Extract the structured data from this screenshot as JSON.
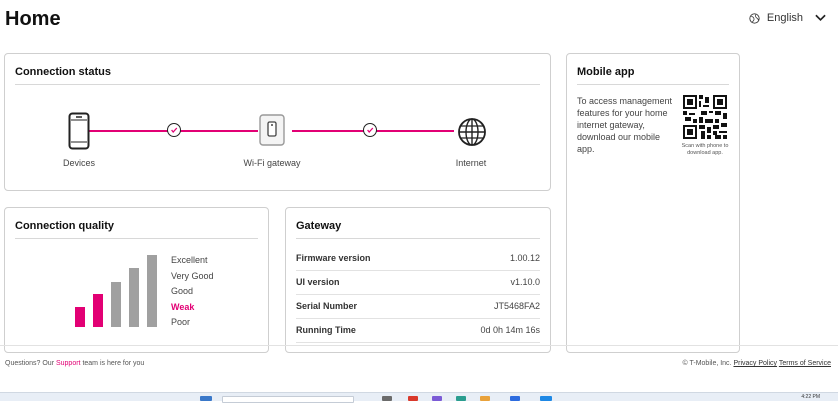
{
  "header": {
    "title": "Home",
    "language": "English",
    "globe_icon": "globe-icon",
    "chevron_icon": "chevron-down-icon"
  },
  "connection_status": {
    "title": "Connection status",
    "nodes": [
      {
        "label": "Devices",
        "icon": "phone-icon"
      },
      {
        "label": "Wi-Fi gateway",
        "icon": "gateway-icon"
      },
      {
        "label": "Internet",
        "icon": "globe-icon"
      }
    ],
    "status_icon": "check-circle-icon",
    "accent_color": "#e20074"
  },
  "mobile_app": {
    "title": "Mobile app",
    "description": "To access management features for your home internet gateway, download our mobile app.",
    "qr_icon": "qr-code-icon",
    "qr_caption": "Scan with phone to download app."
  },
  "connection_quality": {
    "title": "Connection quality",
    "levels": [
      "Excellent",
      "Very Good",
      "Good",
      "Weak",
      "Poor"
    ],
    "current": "Weak",
    "active_bars": 2,
    "total_bars": 5,
    "active_color": "#e20074",
    "inactive_color": "#a0a0a0"
  },
  "gateway": {
    "title": "Gateway",
    "rows": [
      {
        "label": "Firmware version",
        "value": "1.00.12"
      },
      {
        "label": "UI version",
        "value": "v1.10.0"
      },
      {
        "label": "Serial Number",
        "value": "JT5468FA2"
      },
      {
        "label": "Running Time",
        "value": "0d 0h 14m 16s"
      }
    ]
  },
  "footer": {
    "left_prefix": "Questions? Our ",
    "support_link": "Support",
    "left_suffix": " team is here for you",
    "copyright": "© T-Mobile, Inc.",
    "privacy_link": "Privacy Policy",
    "terms_link": "Terms of Service"
  },
  "taskbar": {
    "clock": "4:22 PM"
  }
}
